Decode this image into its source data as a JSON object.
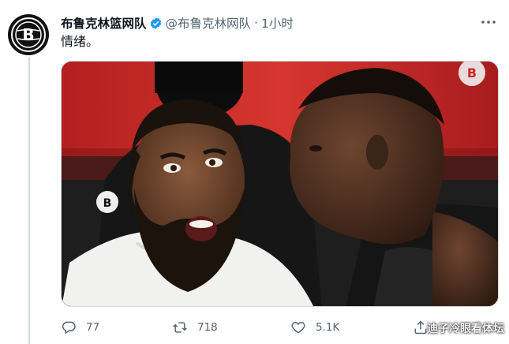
{
  "tweet": {
    "account_name": "布鲁克林篮网队",
    "handle": "@布鲁克林网队",
    "separator": "·",
    "time": "1小时",
    "text": "情绪。",
    "verified": true
  },
  "actions": {
    "replies": "77",
    "retweets": "718",
    "likes": "5.1K"
  },
  "watermark": "迪子冷眼看体坛",
  "colors": {
    "verified_blue": "#1d9bf0",
    "secondary_text": "#536471",
    "media_red": "#c7282b"
  },
  "icons": {
    "avatar": "nets-logo-icon",
    "media_corner": "nets-logo-icon",
    "reply": "reply-icon",
    "retweet": "retweet-icon",
    "like": "heart-icon",
    "share": "share-icon",
    "more": "more-icon"
  }
}
